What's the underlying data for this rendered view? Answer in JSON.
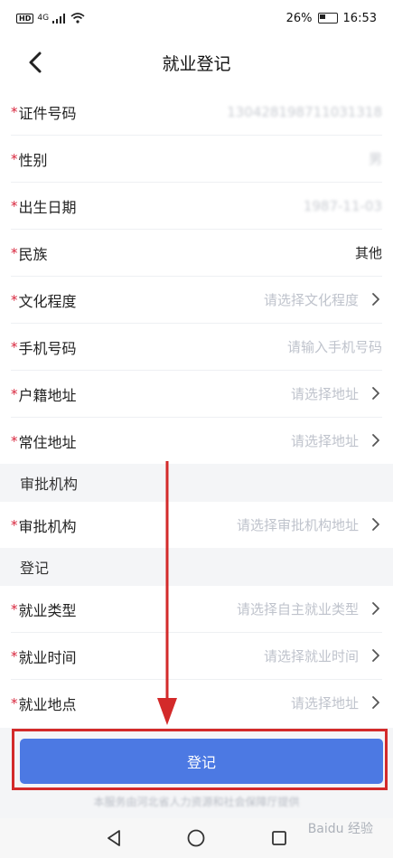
{
  "status_bar": {
    "network": "HD",
    "signal_label": "4G",
    "battery": "26%",
    "time": "16:53"
  },
  "header": {
    "title": "就业登记"
  },
  "required_mark": "*",
  "fields_top": [
    {
      "label": "证件号码",
      "value": "130428198711031318",
      "style": "blurred",
      "chevron": false
    },
    {
      "label": "性别",
      "value": "男",
      "style": "blurred",
      "chevron": false
    },
    {
      "label": "出生日期",
      "value": "1987-11-03",
      "style": "blurred",
      "chevron": false
    },
    {
      "label": "民族",
      "value": "其他",
      "style": "dark",
      "chevron": false
    },
    {
      "label": "文化程度",
      "value": "请选择文化程度",
      "style": "placeholder",
      "chevron": true
    },
    {
      "label": "手机号码",
      "value": "请输入手机号码",
      "style": "placeholder",
      "chevron": false
    },
    {
      "label": "户籍地址",
      "value": "请选择地址",
      "style": "placeholder",
      "chevron": true
    },
    {
      "label": "常住地址",
      "value": "请选择地址",
      "style": "placeholder",
      "chevron": true
    }
  ],
  "section_approval": {
    "title": "审批机构",
    "fields": [
      {
        "label": "审批机构",
        "value": "请选择审批机构地址",
        "chevron": true
      }
    ]
  },
  "section_register": {
    "title": "登记",
    "fields": [
      {
        "label": "就业类型",
        "value": "请选择自主就业类型",
        "chevron": true
      },
      {
        "label": "就业时间",
        "value": "请选择就业时间",
        "chevron": true
      },
      {
        "label": "就业地点",
        "value": "请选择地址",
        "chevron": true
      }
    ]
  },
  "submit_label": "登记",
  "footer_note": "本服务由河北省人力资源和社会保障厅提供",
  "watermark": "Baidu 经验",
  "colors": {
    "accent": "#4c79e3",
    "required": "#d8253c",
    "annotation": "#d32a2a"
  }
}
